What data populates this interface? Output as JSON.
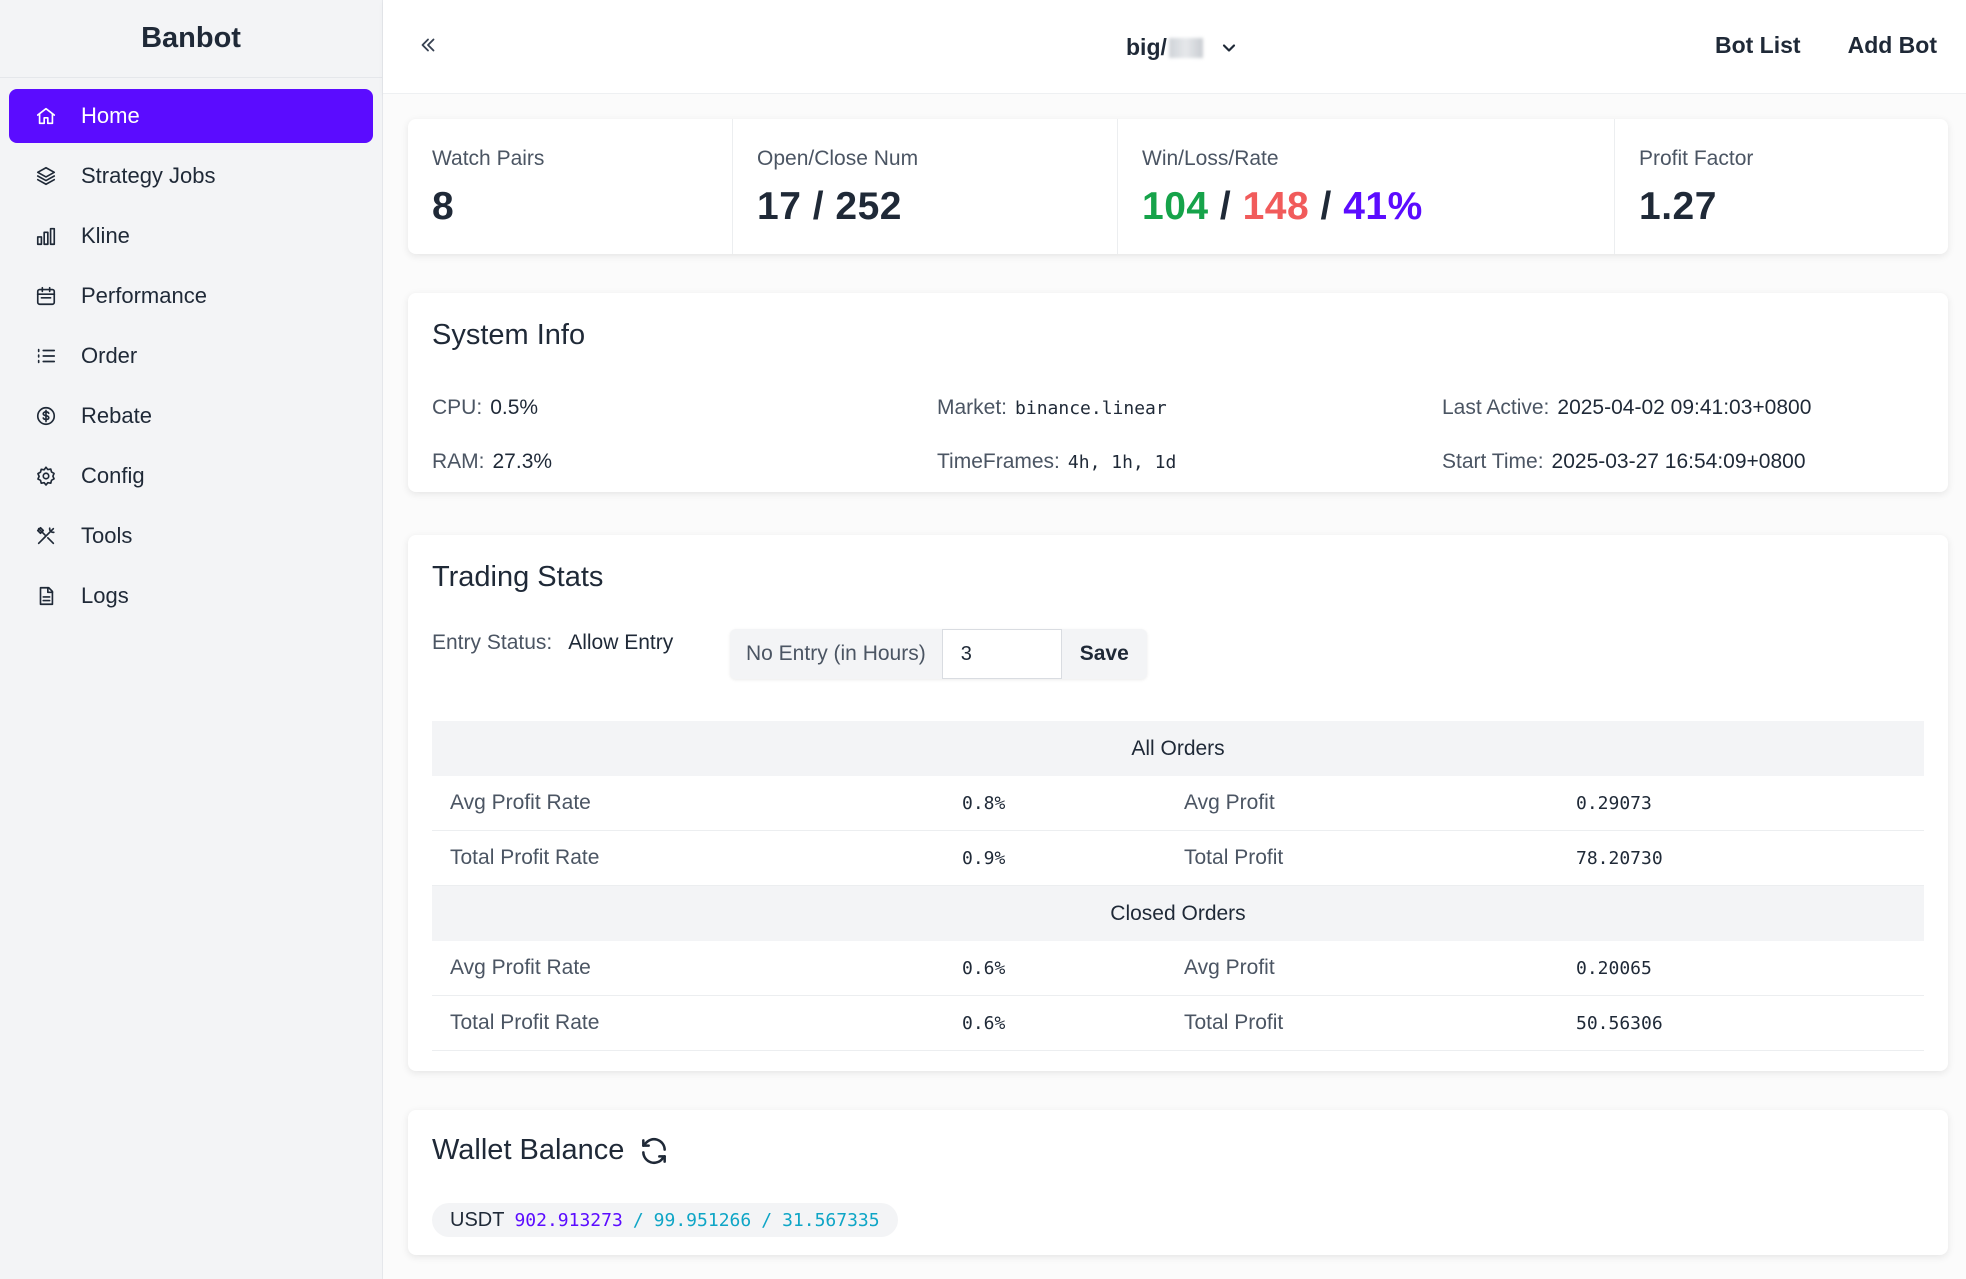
{
  "brand": "Banbot",
  "sidebar": {
    "items": [
      {
        "label": "Home",
        "icon": "home-icon",
        "active": true
      },
      {
        "label": "Strategy Jobs",
        "icon": "layers-icon"
      },
      {
        "label": "Kline",
        "icon": "bar-chart-icon"
      },
      {
        "label": "Performance",
        "icon": "calendar-icon"
      },
      {
        "label": "Order",
        "icon": "list-icon"
      },
      {
        "label": "Rebate",
        "icon": "dollar-circle-icon"
      },
      {
        "label": "Config",
        "icon": "gear-icon"
      },
      {
        "label": "Tools",
        "icon": "tools-icon"
      },
      {
        "label": "Logs",
        "icon": "file-icon"
      }
    ]
  },
  "topbar": {
    "bot_name": "big/",
    "links": {
      "bot_list": "Bot List",
      "add_bot": "Add Bot"
    }
  },
  "stats": {
    "watch_pairs": {
      "label": "Watch Pairs",
      "value": "8"
    },
    "open_close": {
      "label": "Open/Close Num",
      "value": "17 / 252"
    },
    "win_loss": {
      "label": "Win/Loss/Rate",
      "win": "104",
      "loss": "148",
      "rate": "41%",
      "sep": " / "
    },
    "profit_factor": {
      "label": "Profit Factor",
      "value": "1.27"
    }
  },
  "system_info": {
    "title": "System Info",
    "cpu": {
      "label": "CPU:",
      "value": "0.5%"
    },
    "ram": {
      "label": "RAM:",
      "value": "27.3%"
    },
    "market": {
      "label": "Market:",
      "value": "binance.linear"
    },
    "timeframes": {
      "label": "TimeFrames:",
      "value": "4h, 1h, 1d"
    },
    "last_active": {
      "label": "Last Active:",
      "value": "2025-04-02 09:41:03+0800"
    },
    "start_time": {
      "label": "Start Time:",
      "value": "2025-03-27 16:54:09+0800"
    }
  },
  "trading_stats": {
    "title": "Trading Stats",
    "entry_status": {
      "label": "Entry Status:",
      "value": "Allow Entry"
    },
    "no_entry": {
      "label": "No Entry (in Hours)",
      "value": "3",
      "save_label": "Save"
    },
    "all_orders": {
      "header": "All Orders",
      "rows": [
        {
          "label_a": "Avg Profit Rate",
          "value_a": "0.8%",
          "label_b": "Avg Profit",
          "value_b": "0.29073"
        },
        {
          "label_a": "Total Profit Rate",
          "value_a": "0.9%",
          "label_b": "Total Profit",
          "value_b": "78.20730"
        }
      ]
    },
    "closed_orders": {
      "header": "Closed Orders",
      "rows": [
        {
          "label_a": "Avg Profit Rate",
          "value_a": "0.6%",
          "label_b": "Avg Profit",
          "value_b": "0.20065"
        },
        {
          "label_a": "Total Profit Rate",
          "value_a": "0.6%",
          "label_b": "Total Profit",
          "value_b": "50.56306"
        }
      ]
    }
  },
  "wallet": {
    "title": "Wallet Balance",
    "currency": "USDT",
    "total": "902.913273",
    "available": "99.951266",
    "unrealized": "31.567335",
    "sep": "/"
  },
  "colors": {
    "accent": "#5b0cff",
    "win": "#16a34a",
    "loss": "#f15b5b",
    "secondary_value": "#0ea5c6"
  }
}
